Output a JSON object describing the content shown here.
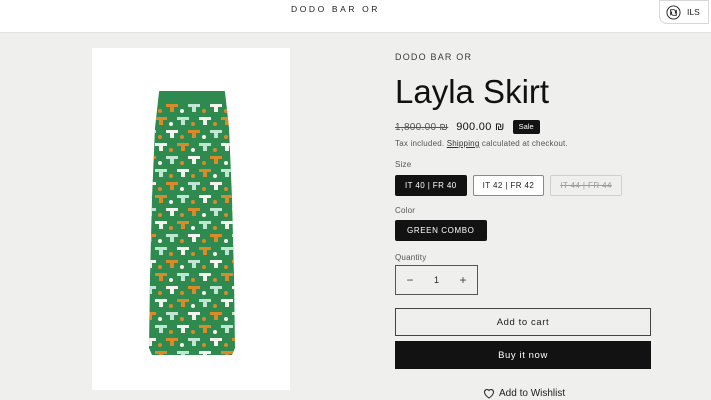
{
  "header": {
    "store_name": "DODO BAR OR",
    "currency": "ILS",
    "currency_icon": "shekel-circle-icon"
  },
  "product": {
    "vendor": "DODO BAR OR",
    "title": "Layla Skirt",
    "price_original": "1,800.00 ₪",
    "price_sale": "900.00 ₪",
    "sale_badge": "Sale",
    "tax_prefix": "Tax included.",
    "tax_link": "Shipping",
    "tax_suffix": "calculated at checkout.",
    "image_colors": {
      "base": "#2e8a4e",
      "orange": "#d98a2b",
      "mint": "#bfe6d2",
      "white": "#f4f4ee"
    }
  },
  "options": {
    "size_label": "Size",
    "sizes": [
      {
        "label": "IT 40 | FR 40",
        "state": "selected"
      },
      {
        "label": "IT 42 | FR 42",
        "state": "available"
      },
      {
        "label": "IT 44 | FR 44",
        "state": "sold-out"
      }
    ],
    "color_label": "Color",
    "color_value": "GREEN COMBO",
    "quantity_label": "Quantity",
    "quantity": "1",
    "minus_symbol": "−",
    "plus_symbol": "+"
  },
  "actions": {
    "add_to_cart": "Add to cart",
    "buy_now": "Buy it now",
    "wishlist": "Add to Wishlist"
  }
}
